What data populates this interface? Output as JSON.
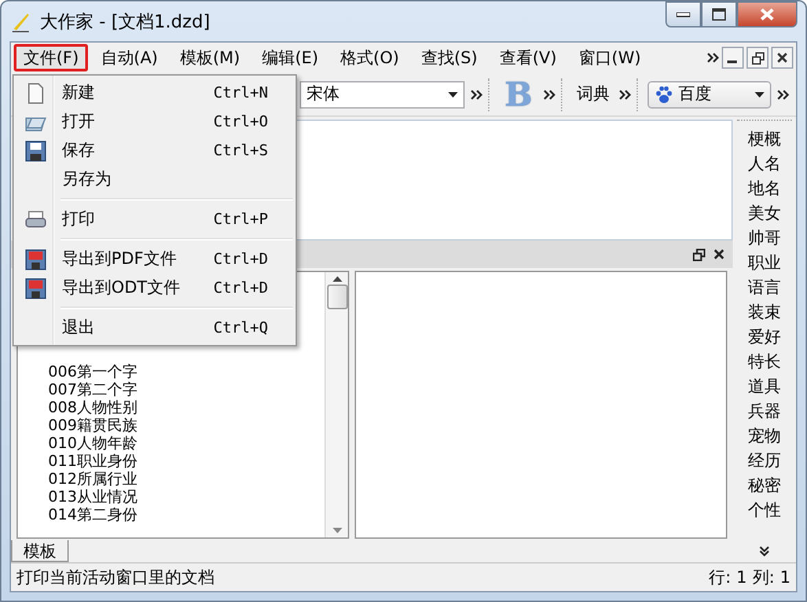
{
  "window": {
    "title": "大作家 - [文档1.dzd]"
  },
  "menu_bar": [
    {
      "label": "文件(F)",
      "selected": true
    },
    {
      "label": "自动(A)",
      "selected": false
    },
    {
      "label": "模板(M)",
      "selected": false
    },
    {
      "label": "编辑(E)",
      "selected": false
    },
    {
      "label": "格式(O)",
      "selected": false
    },
    {
      "label": "查找(S)",
      "selected": false
    },
    {
      "label": "查看(V)",
      "selected": false
    },
    {
      "label": "窗口(W)",
      "selected": false
    }
  ],
  "file_menu": [
    {
      "kind": "item",
      "label": "新建",
      "shortcut": "Ctrl+N"
    },
    {
      "kind": "item",
      "label": "打开",
      "shortcut": "Ctrl+O"
    },
    {
      "kind": "item",
      "label": "保存",
      "shortcut": "Ctrl+S"
    },
    {
      "kind": "item",
      "label": "另存为"
    },
    {
      "kind": "separator"
    },
    {
      "kind": "item",
      "label": "打印",
      "shortcut": "Ctrl+P"
    },
    {
      "kind": "separator"
    },
    {
      "kind": "item",
      "label": "导出到PDF文件",
      "shortcut": "Ctrl+D"
    },
    {
      "kind": "item",
      "label": "导出到ODT文件",
      "shortcut": "Ctrl+D"
    },
    {
      "kind": "separator"
    },
    {
      "kind": "item",
      "label": "退出",
      "shortcut": "Ctrl+Q"
    }
  ],
  "toolbar": {
    "font": "宋体",
    "bold_button": "B",
    "dictionary": "词典",
    "search_engine": "百度"
  },
  "sidebar": {
    "items": [
      "梗概",
      "人名",
      "地名",
      "美女",
      "帅哥",
      "职业",
      "语言",
      "装束",
      "爱好",
      "特长",
      "道具",
      "兵器",
      "宠物",
      "经历",
      "秘密",
      "个性"
    ]
  },
  "template_list": {
    "items": [
      "006第一个字",
      "007第二个字",
      "008人物性别",
      "009籍贯民族",
      "010人物年龄",
      "011职业身份",
      "012所属行业",
      "013从业情况",
      "014第二身份"
    ]
  },
  "tabs": [
    {
      "label": "模板",
      "selected": true
    }
  ],
  "status_bar": {
    "message": "打印当前活动窗口里的文档",
    "line_label": "行:",
    "line": "1",
    "column_label": "列:",
    "column": "1"
  }
}
